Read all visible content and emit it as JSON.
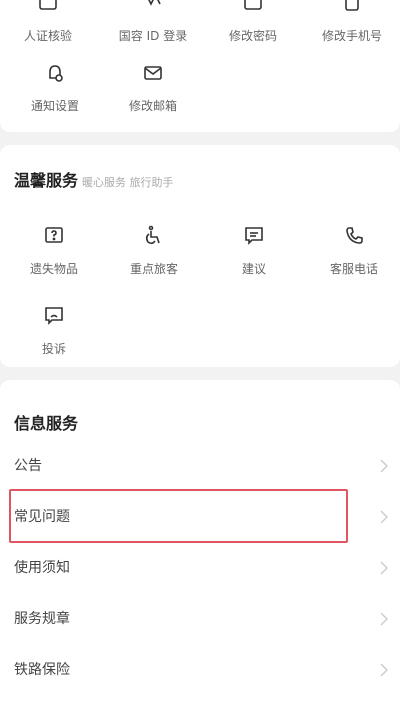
{
  "account_security": {
    "items": [
      {
        "label": "人证核验",
        "icon": "id-verify-icon"
      },
      {
        "label": "国容 ID 登录",
        "icon": "login-icon"
      },
      {
        "label": "修改密码",
        "icon": "password-icon"
      },
      {
        "label": "修改手机号",
        "icon": "phone-icon"
      },
      {
        "label": "通知设置",
        "icon": "bell-icon"
      },
      {
        "label": "修改邮箱",
        "icon": "mail-icon"
      }
    ]
  },
  "warm_service": {
    "title": "温馨服务",
    "subtitle": "暖心服务 旅行助手",
    "items": [
      {
        "label": "遗失物品",
        "icon": "question-box-icon"
      },
      {
        "label": "重点旅客",
        "icon": "wheelchair-icon"
      },
      {
        "label": "建议",
        "icon": "suggestion-icon"
      },
      {
        "label": "客服电话",
        "icon": "phone-call-icon"
      },
      {
        "label": "投诉",
        "icon": "complaint-icon"
      }
    ]
  },
  "info_service": {
    "title": "信息服务",
    "items": [
      {
        "label": "公告"
      },
      {
        "label": "常见问题"
      },
      {
        "label": "使用须知"
      },
      {
        "label": "服务规章"
      },
      {
        "label": "铁路保险"
      }
    ]
  },
  "colors": {
    "highlight": "#e0555f",
    "icon_stroke": "#333333",
    "chevron": "#cccccc"
  }
}
